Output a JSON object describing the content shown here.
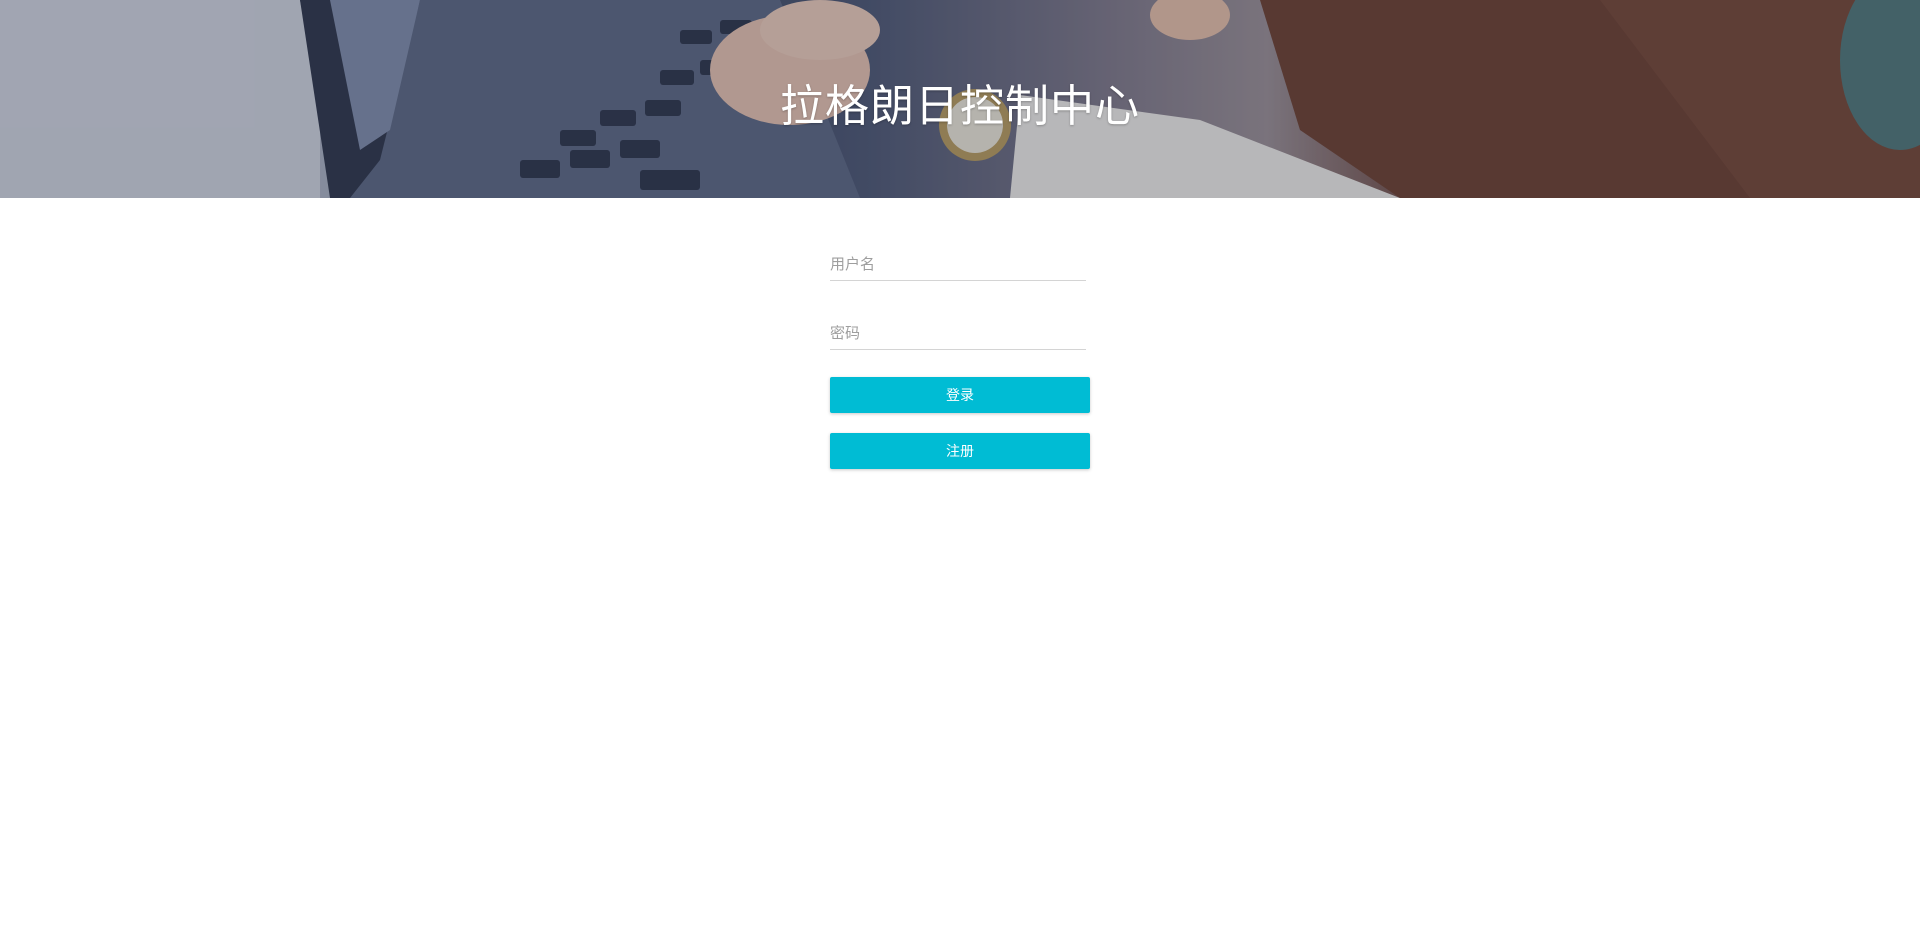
{
  "header": {
    "title": "拉格朗日控制中心"
  },
  "login_form": {
    "username_placeholder": "用户名",
    "password_placeholder": "密码",
    "login_label": "登录",
    "register_label": "注册"
  },
  "colors": {
    "primary_button": "#00bcd4",
    "title_text": "#ffffff"
  }
}
